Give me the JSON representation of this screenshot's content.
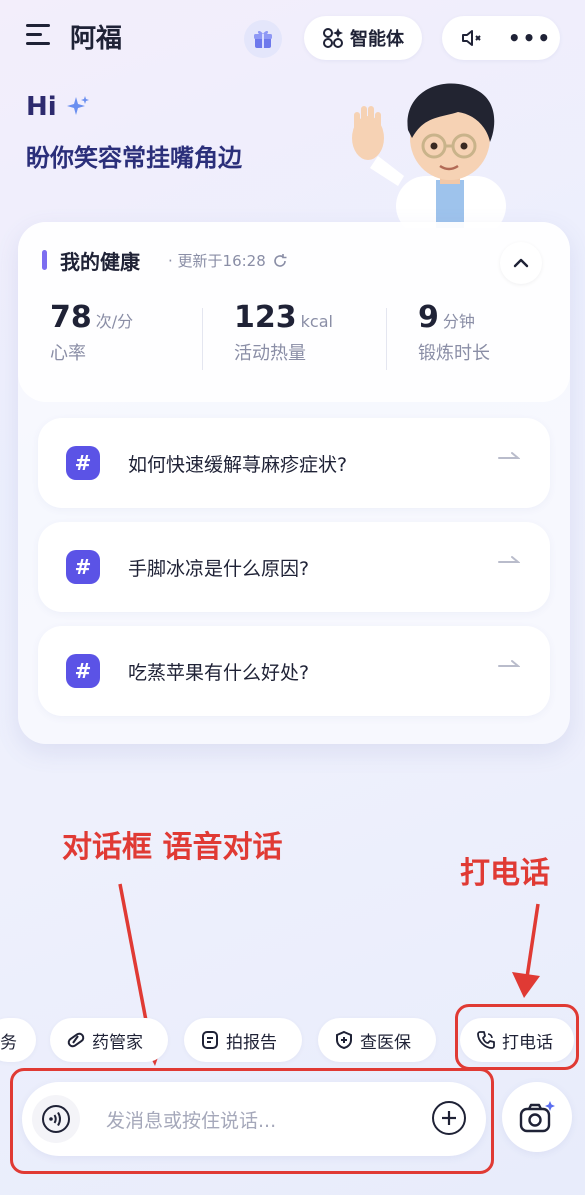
{
  "header": {
    "app_title": "阿福",
    "agent_label": "智能体",
    "more_label": "•••"
  },
  "greeting": {
    "hi": "Hi",
    "tagline": "盼你笑容常挂嘴角边"
  },
  "health": {
    "title": "我的健康",
    "updated": "· 更新于16:28",
    "stats": [
      {
        "value": "78",
        "unit": "次/分",
        "label": "心率"
      },
      {
        "value": "123",
        "unit": "kcal",
        "label": "活动热量"
      },
      {
        "value": "9",
        "unit": "分钟",
        "label": "锻炼时长"
      }
    ]
  },
  "questions": [
    {
      "text": "如何快速缓解荨麻疹症状?"
    },
    {
      "text": "手脚冰凉是什么原因?"
    },
    {
      "text": "吃蒸苹果有什么好处?"
    }
  ],
  "annotations": {
    "dialog": "对话框 语音对话",
    "call": "打电话"
  },
  "chips": [
    {
      "label": "务"
    },
    {
      "label": "药管家"
    },
    {
      "label": "拍报告"
    },
    {
      "label": "查医保"
    },
    {
      "label": "打电话"
    }
  ],
  "input": {
    "placeholder": "发消息或按住说话..."
  },
  "colors": {
    "accent": "#5b53e6",
    "annotation": "#e03a34"
  },
  "icons": [
    "menu-icon",
    "gift-icon",
    "agent-icon",
    "mute-icon",
    "more-icon",
    "sparkle-icon",
    "refresh-icon",
    "chevron-up-icon",
    "hash-icon",
    "arrow-right-icon",
    "pill-icon",
    "report-icon",
    "insurance-icon",
    "phone-icon",
    "voice-icon",
    "plus-icon",
    "camera-icon"
  ]
}
